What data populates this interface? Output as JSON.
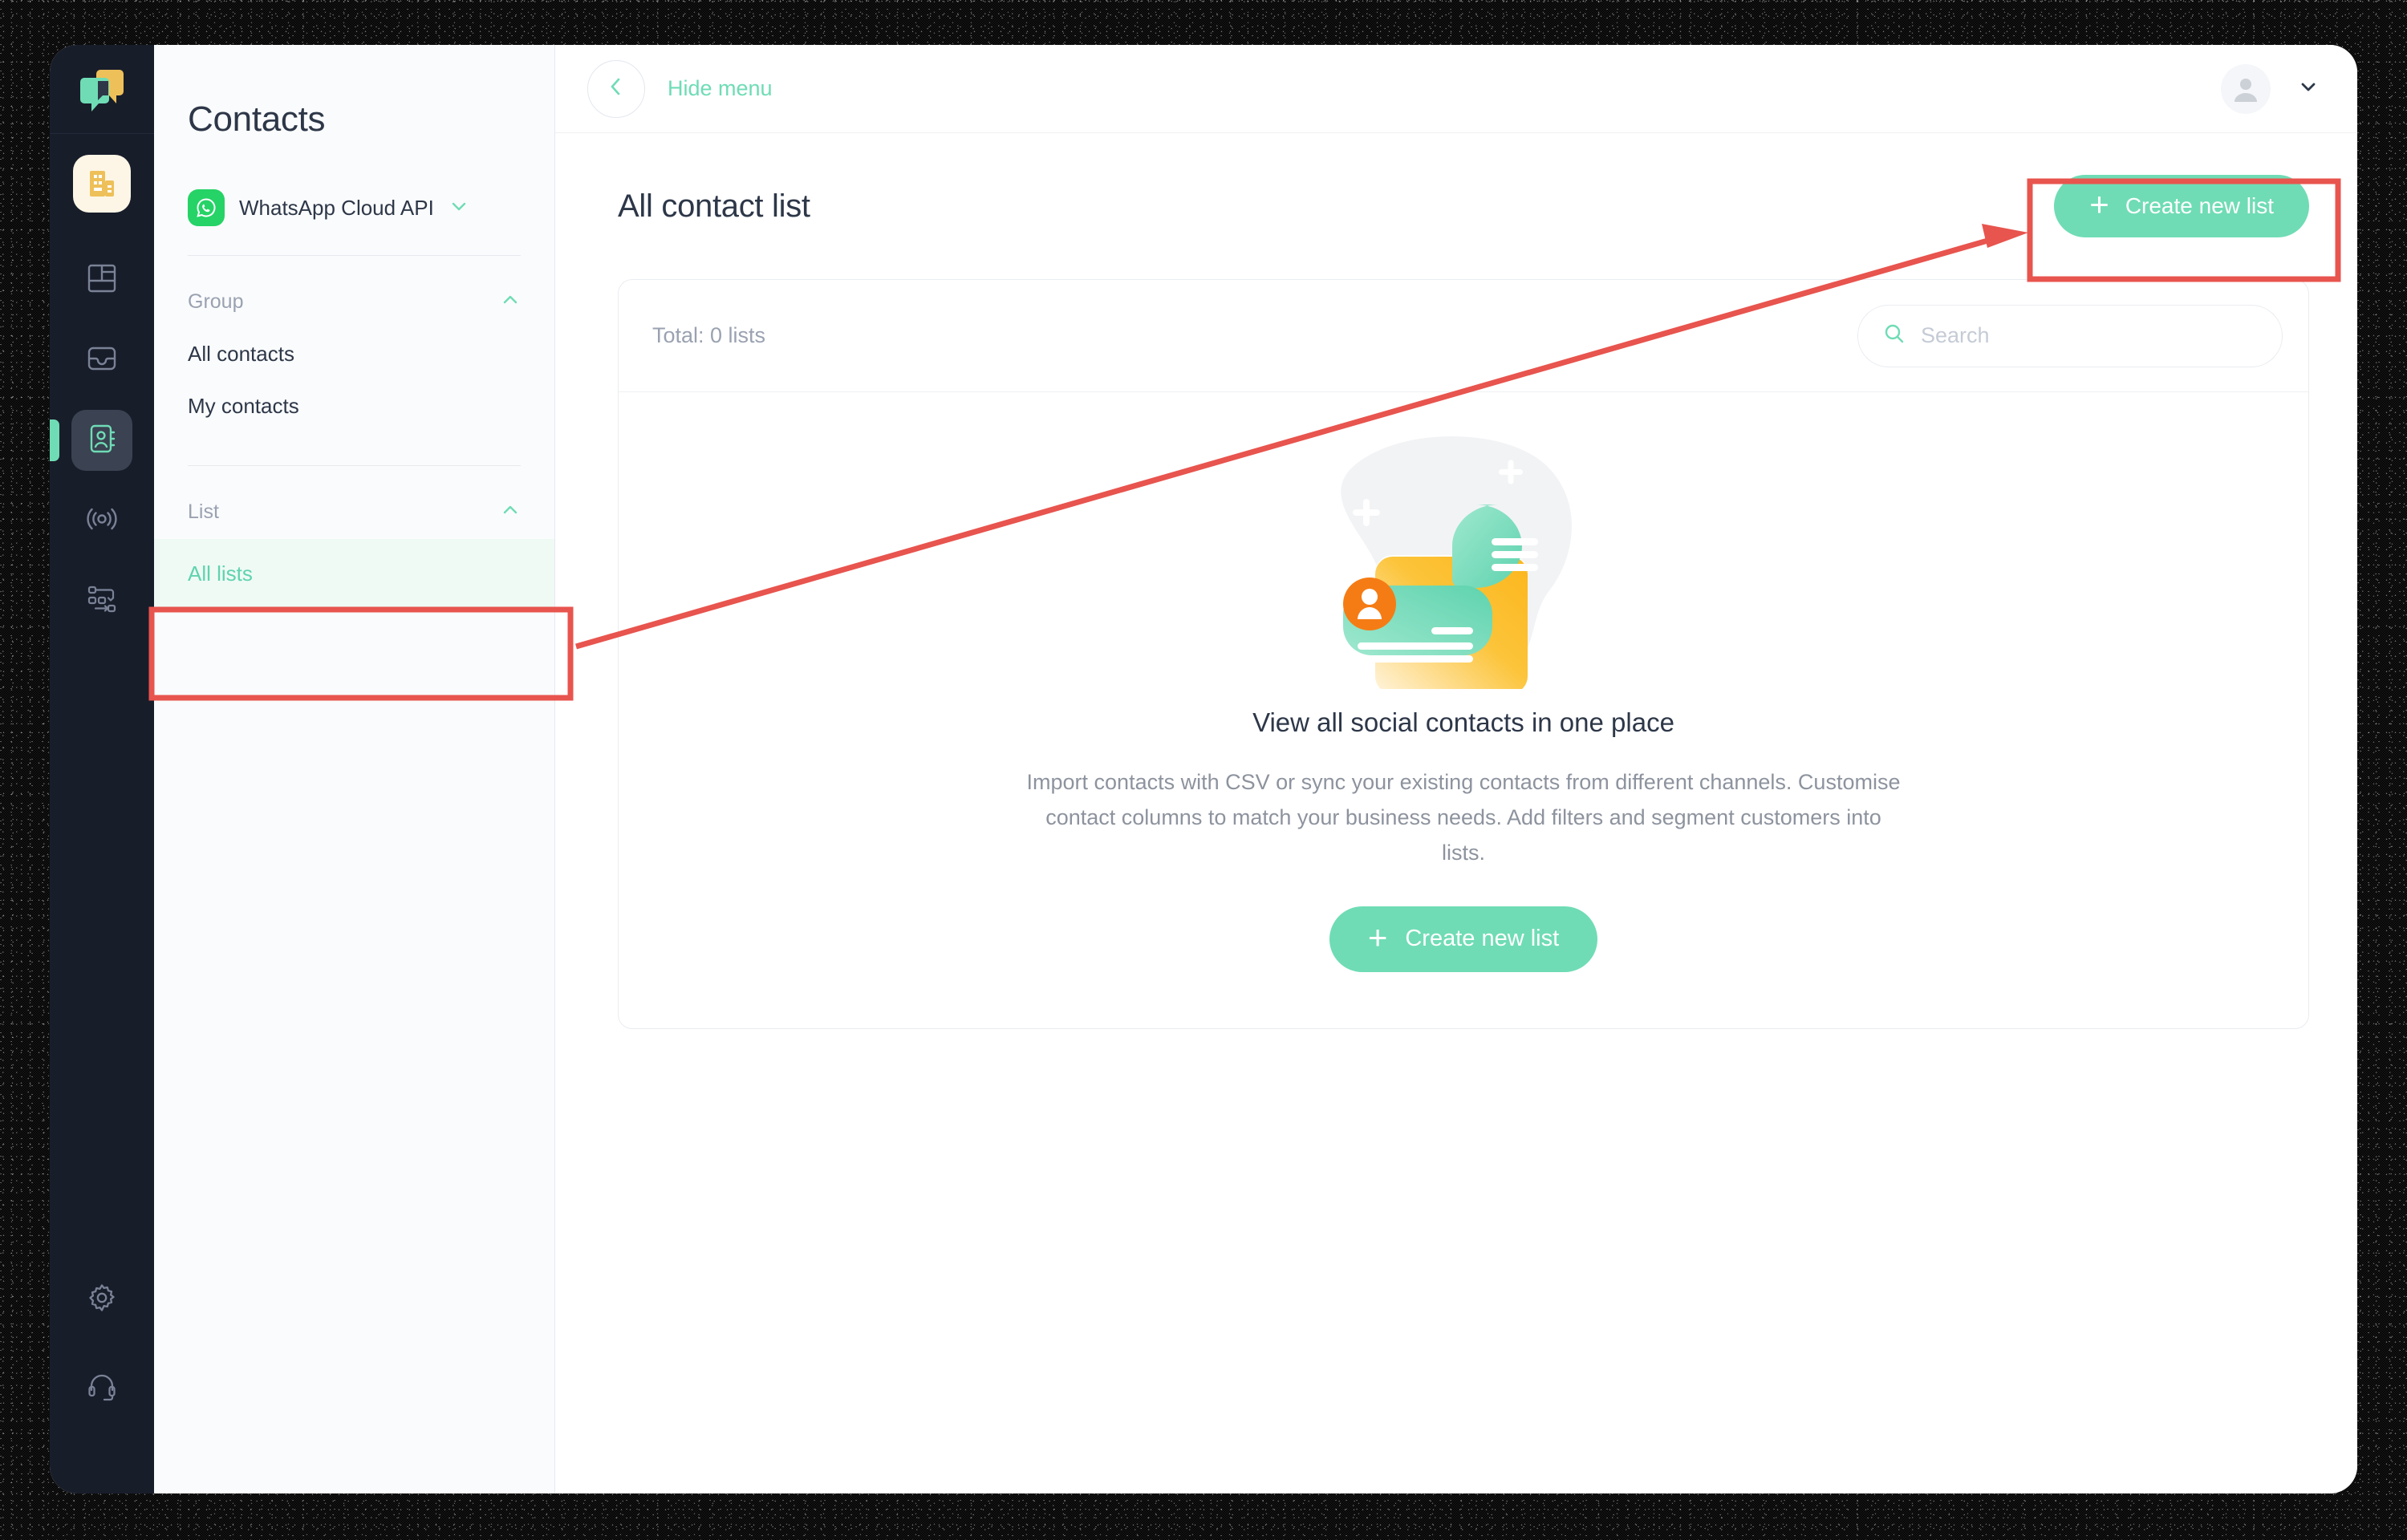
{
  "colors": {
    "accent": "#6fdcb5",
    "accent_light": "#effaf5",
    "rail_bg": "#181d2a",
    "annotation": "#e8544e",
    "whatsapp_green": "#25d366",
    "text_dark": "#2d3748",
    "text_muted": "#9aa2b1"
  },
  "rail": {
    "logo_icon": "chat-bubbles-logo-icon",
    "app_icon": "business-building-icon",
    "nav": [
      {
        "icon": "dashboard-layout-icon",
        "name": "dashboard",
        "active": false
      },
      {
        "icon": "inbox-icon",
        "name": "inbox",
        "active": false
      },
      {
        "icon": "contacts-book-icon",
        "name": "contacts",
        "active": true
      },
      {
        "icon": "broadcast-signal-icon",
        "name": "broadcast",
        "active": false
      },
      {
        "icon": "automation-flow-icon",
        "name": "automation",
        "active": false
      }
    ],
    "bottom_nav": [
      {
        "icon": "gear-icon",
        "name": "settings"
      },
      {
        "icon": "headset-support-icon",
        "name": "support"
      }
    ]
  },
  "panel": {
    "title": "Contacts",
    "channel": {
      "icon": "whatsapp-icon",
      "name": "WhatsApp Cloud API",
      "chevron": "chevron-down-icon"
    },
    "sections": [
      {
        "label": "Group",
        "chevron": "chevron-up-icon",
        "items": [
          {
            "label": "All contacts",
            "active": false
          },
          {
            "label": "My contacts",
            "active": false
          }
        ]
      },
      {
        "label": "List",
        "chevron": "chevron-up-icon",
        "items": [
          {
            "label": "All lists",
            "active": true
          }
        ]
      }
    ]
  },
  "topbar": {
    "back_icon": "chevron-left-icon",
    "hide_menu_label": "Hide menu",
    "avatar_icon": "user-avatar-icon",
    "account_chevron": "chevron-down-icon"
  },
  "main": {
    "page_title": "All contact list",
    "create_button_label": "Create new list",
    "create_button_icon": "plus-icon",
    "toolbar": {
      "total_text": "Total: 0 lists",
      "search_icon": "search-icon",
      "search_placeholder": "Search",
      "search_value": ""
    },
    "empty_state": {
      "illustration": "contacts-cards-illustration",
      "title": "View all social contacts in one place",
      "description": "Import contacts with CSV or sync your existing contacts from different channels. Customise contact columns to match your business needs. Add filters and segment customers into lists.",
      "button_label": "Create new list",
      "button_icon": "plus-icon"
    }
  },
  "annotations": {
    "highlight_sidebar": "All lists",
    "highlight_button": "Create new list",
    "arrow": "red-arrow-pointing-right"
  }
}
